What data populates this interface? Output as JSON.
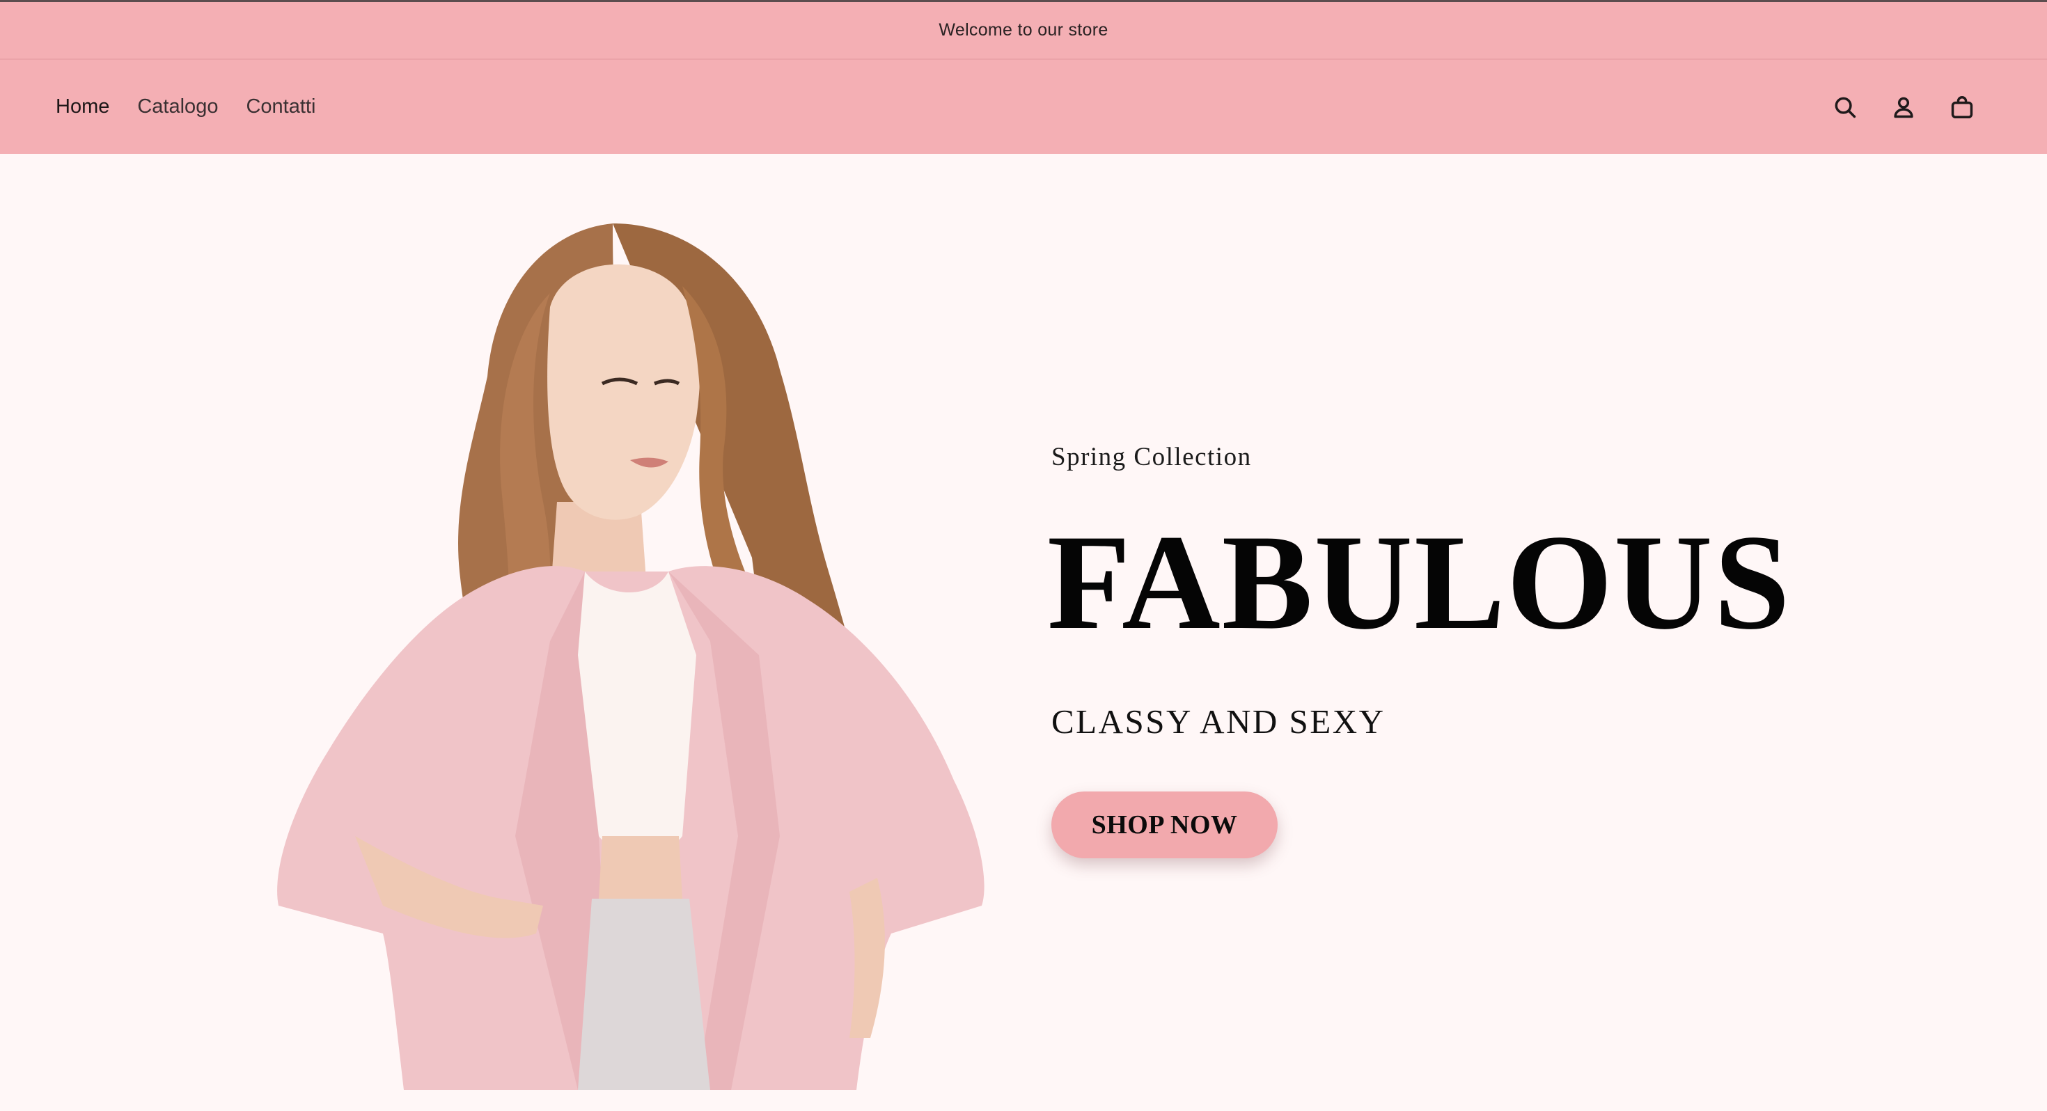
{
  "announcement": {
    "text": "Welcome to our store"
  },
  "nav": {
    "items": [
      {
        "label": "Home"
      },
      {
        "label": "Catalogo"
      },
      {
        "label": "Contatti"
      }
    ]
  },
  "header_icons": [
    "search-icon",
    "account-icon",
    "cart-icon"
  ],
  "hero": {
    "subtitle": "Spring Collection",
    "headline": "FABULOUS",
    "tagline": "CLASSY AND SEXY",
    "cta_label": "SHOP NOW"
  },
  "colors": {
    "header_bg": "#f4afb4",
    "page_bg": "#fff7f7",
    "cta_bg": "#f2a9ad",
    "coat": "#f0c4c8"
  }
}
